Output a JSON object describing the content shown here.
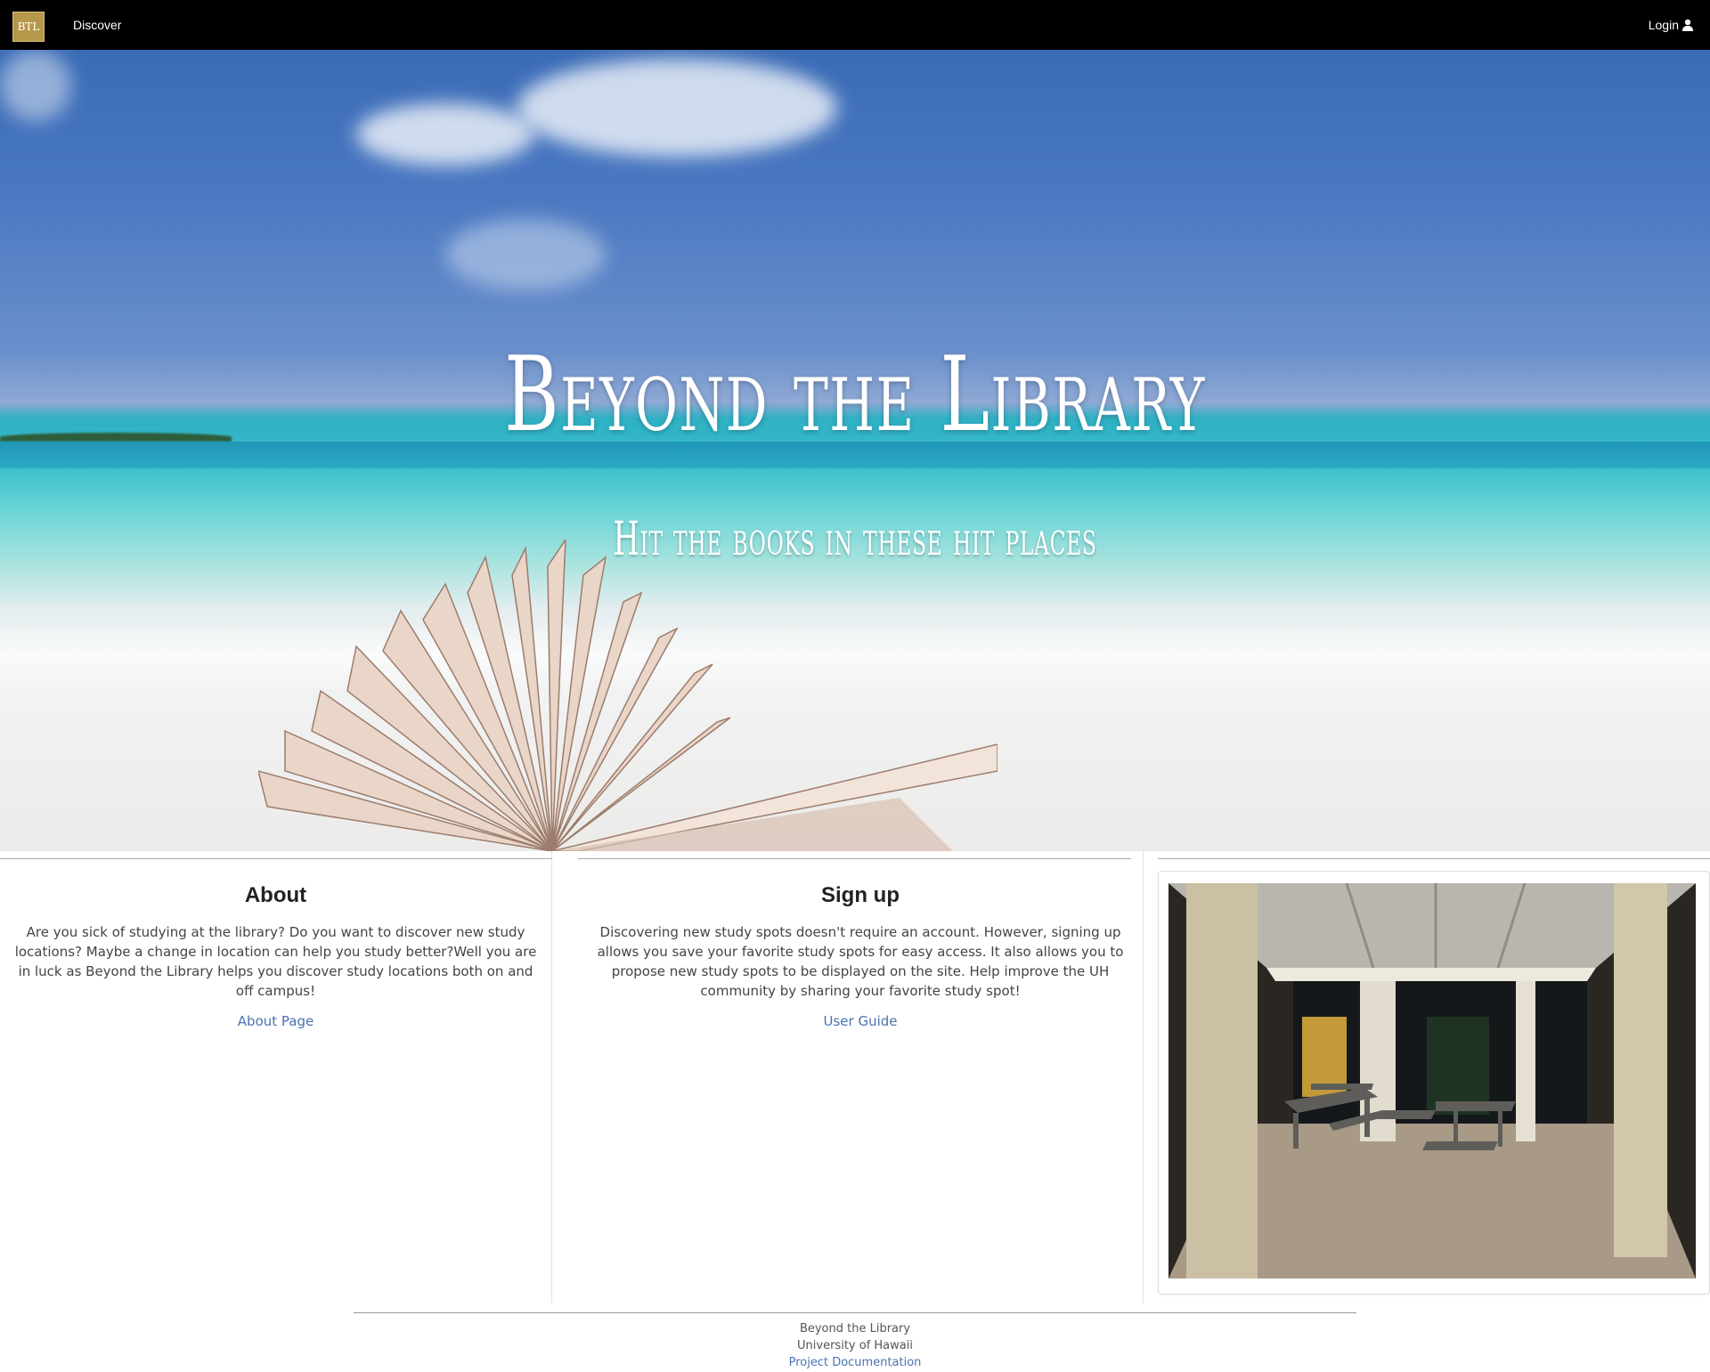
{
  "navbar": {
    "logo_text": "BTL",
    "discover_label": "Discover",
    "login_label": "Login",
    "login_icon": "user-icon",
    "colors": {
      "background": "#000000",
      "logo": "#b7974a",
      "text": "#ffffff"
    }
  },
  "hero": {
    "title": "Beyond the Library",
    "subtitle": "Hit the books in these hit places",
    "image": "beach-with-open-book"
  },
  "about": {
    "heading": "About",
    "text": "Are you sick of studying at the library? Do you want to discover new study locations? Maybe a change in location can help you study better?Well you are in luck as Beyond the Library helps you discover study locations both on and off campus!",
    "link_label": "About Page"
  },
  "signup": {
    "heading": "Sign up",
    "text": "Discovering new study spots doesn't require an account. However, signing up allows you save your favorite study spots for easy access. It also allows you to propose new study spots to be displayed on the site. Help improve the UH community by sharing your favorite study spot!",
    "link_label": "User Guide"
  },
  "photo": {
    "subject": "covered-courtyard-with-picnic-tables-at-night"
  },
  "footer": {
    "line1": "Beyond the Library",
    "line2": "University of Hawaii",
    "link_label": "Project Documentation"
  },
  "colors": {
    "link": "#4a72b0",
    "divider": "#a9a9a9"
  }
}
